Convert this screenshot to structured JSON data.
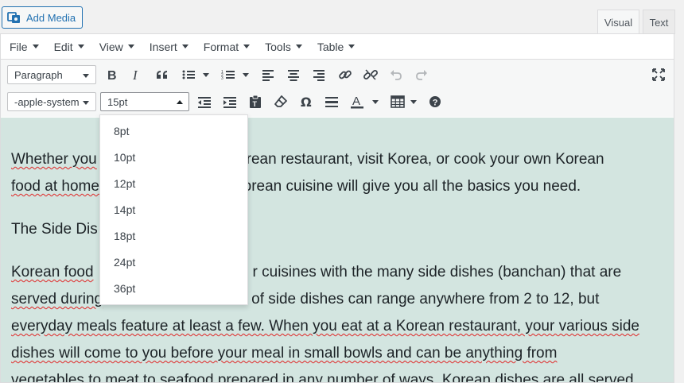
{
  "header": {
    "add_media_label": "Add Media",
    "tabs": [
      {
        "label": "Visual",
        "active": true
      },
      {
        "label": "Text",
        "active": false
      }
    ]
  },
  "menubar": {
    "items": [
      {
        "label": "File"
      },
      {
        "label": "Edit"
      },
      {
        "label": "View"
      },
      {
        "label": "Insert"
      },
      {
        "label": "Format"
      },
      {
        "label": "Tools"
      },
      {
        "label": "Table"
      }
    ]
  },
  "toolbar1": {
    "block_format_value": "Paragraph",
    "buttons": [
      "bold-icon",
      "italic-icon",
      "blockquote-icon",
      "bullet-list-icon",
      "numbered-list-icon",
      "align-left-icon",
      "align-center-icon",
      "align-right-icon",
      "link-icon",
      "unlink-icon",
      "undo-icon",
      "redo-icon",
      "fullscreen-icon"
    ]
  },
  "toolbar2": {
    "font_family_value": "-apple-system",
    "font_size_value": "15pt",
    "buttons": [
      "outdent-icon",
      "indent-icon",
      "paste-text-icon",
      "clear-formatting-icon",
      "omega-icon",
      "horizontal-line-icon",
      "text-color-icon",
      "table-icon",
      "help-icon"
    ]
  },
  "font_size_dropdown": {
    "options": [
      "8pt",
      "10pt",
      "12pt",
      "14pt",
      "18pt",
      "24pt",
      "36pt"
    ]
  },
  "content": {
    "p1_line1": "Whether you",
    "p1_line1b": "n a Korean restaurant, visit Korea, or cook your own Korean",
    "p1_line2a": "food at home",
    "p1_line2b": "tion to Korean cuisine will give you all the basics you need.",
    "heading": "The Side Dis",
    "p2_line1a": "Korean food",
    "p2_line1b": "r cuisines with the many side dishes (banchan) that are",
    "p2_line2a": "served during",
    "p2_line2b": "of side dishes can range anywhere from 2 to 12, but",
    "p2_line3": "everyday meals feature at least a few. When you eat at a Korean restaurant, your various side",
    "p2_line4": "dishes will come to you before your meal in small bowls and can be anything from",
    "p2_line5": "vegetables to meat to seafood prepared in any number of ways. Korean dishes are all served"
  },
  "colors": {
    "content_bg": "#d3e5e0",
    "accent": "#2271b1",
    "spellcheck": "#e02424"
  }
}
